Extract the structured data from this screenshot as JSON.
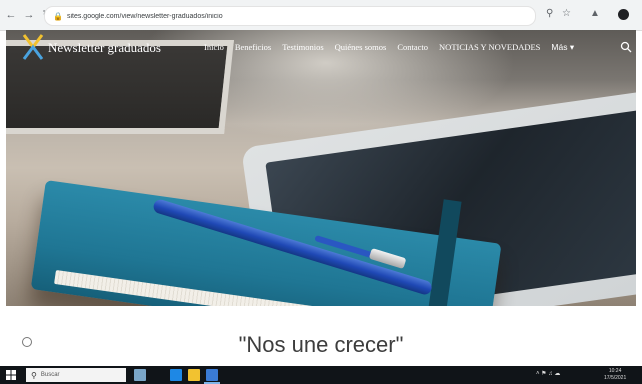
{
  "browser": {
    "url": "sites.google.com/view/newsletter-graduados/inicio",
    "back_icon": "back-arrow-icon",
    "forward_icon": "forward-arrow-icon",
    "reload_icon": "reload-icon",
    "lock_icon": "lock-icon"
  },
  "site": {
    "title": "Newsletter graduados",
    "nav": [
      "Inicio",
      "Beneficios",
      "Testimonios",
      "Quiénes somos",
      "Contacto",
      "NOTICIAS Y NOVEDADES"
    ],
    "more_label": "Más",
    "search_icon": "search-icon"
  },
  "main": {
    "tagline": "\"Nos une crecer\""
  },
  "taskbar": {
    "search_placeholder": "Buscar",
    "clock_time": "10:24",
    "clock_date": "17/5/2021"
  },
  "colors": {
    "brand_blue": "#1f48b5",
    "notebook_teal": "#2b8aa9",
    "logo_yellow": "#f2c230"
  }
}
